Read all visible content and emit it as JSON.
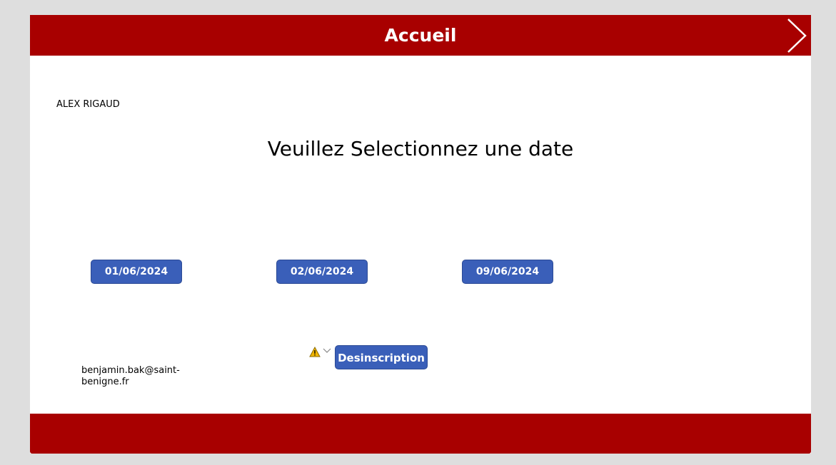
{
  "header": {
    "title": "Accueil",
    "next_icon": "chevron-right-icon"
  },
  "user": {
    "name": "ALEX RIGAUD",
    "email": "benjamin.bak@saint-benigne.fr"
  },
  "prompt": "Veuillez Selectionnez une date",
  "dates": [
    {
      "label": "01/06/2024"
    },
    {
      "label": "02/06/2024"
    },
    {
      "label": "09/06/2024"
    }
  ],
  "unsubscribe": {
    "label": "Desinscription",
    "warning_icon": "warning-icon",
    "dropdown_icon": "chevron-down-icon"
  },
  "colors": {
    "brand": "#a80000",
    "button": "#3a5fb9",
    "background": "#dedede"
  }
}
